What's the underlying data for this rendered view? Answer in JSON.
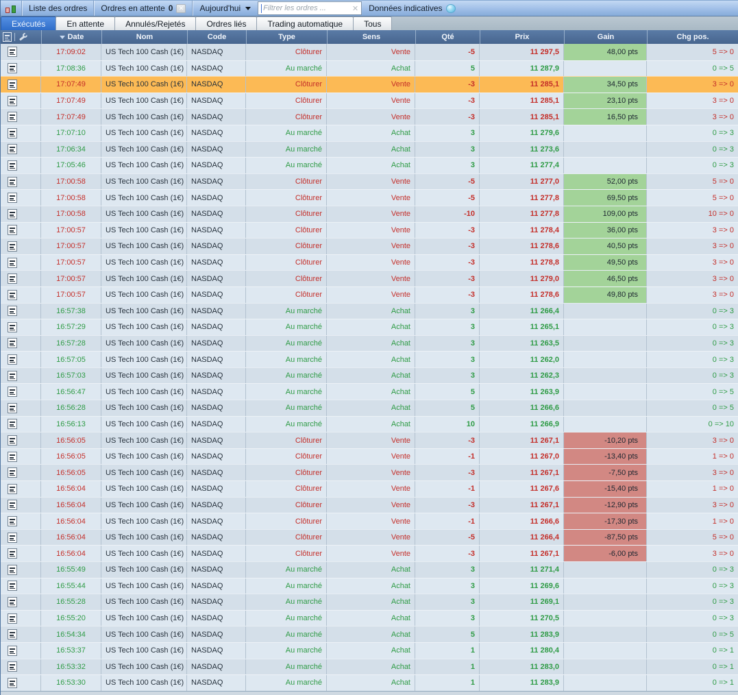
{
  "toolbar": {
    "app_icon": "candlestick-chart-icon",
    "liste_label": "Liste des ordres",
    "attente_label": "Ordres en attente",
    "attente_count": "0",
    "period_label": "Aujourd'hui",
    "filter_placeholder": "Filtrer les ordres ...",
    "clear_icon": "✕",
    "indicative_label": "Données indicatives",
    "indicative_icon": "globe-bubble-icon"
  },
  "tabs": [
    {
      "label": "Exécutés",
      "active": true
    },
    {
      "label": "En attente",
      "active": false
    },
    {
      "label": "Annulés/Rejetés",
      "active": false
    },
    {
      "label": "Ordres liés",
      "active": false
    },
    {
      "label": "Trading automatique",
      "active": false
    },
    {
      "label": "Tous",
      "active": false
    }
  ],
  "colors": {
    "highlight_row": "#fcba55",
    "gain_positive_bg": "#a3d399",
    "gain_negative_bg": "#d28883",
    "sell_text": "#c42e29",
    "buy_text": "#2e9b45",
    "active_tab": "#3f7cd6",
    "header_bg": "#4e6e98"
  },
  "table": {
    "columns": [
      "Date",
      "Nom",
      "Code",
      "Type",
      "Sens",
      "Qté",
      "Prix",
      "Gain",
      "Chg pos."
    ],
    "sort_column": "Date",
    "sort_direction": "desc",
    "rows": [
      {
        "time": "17:09:02",
        "dir": "sell",
        "name": "US Tech 100 Cash (1€)",
        "code": "NASDAQ",
        "type": "Clôturer",
        "sens": "Vente",
        "qty": "-5",
        "price": "11 297,5",
        "gain": "48,00 pts",
        "chg": "5 => 0",
        "highlight": false
      },
      {
        "time": "17:08:36",
        "dir": "buy",
        "name": "US Tech 100 Cash (1€)",
        "code": "NASDAQ",
        "type": "Au marché",
        "sens": "Achat",
        "qty": "5",
        "price": "11 287,9",
        "gain": "",
        "chg": "0 => 5",
        "highlight": false
      },
      {
        "time": "17:07:49",
        "dir": "sell",
        "name": "US Tech 100 Cash (1€)",
        "code": "NASDAQ",
        "type": "Clôturer",
        "sens": "Vente",
        "qty": "-3",
        "price": "11 285,1",
        "gain": "34,50 pts",
        "chg": "3 => 0",
        "highlight": true
      },
      {
        "time": "17:07:49",
        "dir": "sell",
        "name": "US Tech 100 Cash (1€)",
        "code": "NASDAQ",
        "type": "Clôturer",
        "sens": "Vente",
        "qty": "-3",
        "price": "11 285,1",
        "gain": "23,10 pts",
        "chg": "3 => 0",
        "highlight": false
      },
      {
        "time": "17:07:49",
        "dir": "sell",
        "name": "US Tech 100 Cash (1€)",
        "code": "NASDAQ",
        "type": "Clôturer",
        "sens": "Vente",
        "qty": "-3",
        "price": "11 285,1",
        "gain": "16,50 pts",
        "chg": "3 => 0",
        "highlight": false
      },
      {
        "time": "17:07:10",
        "dir": "buy",
        "name": "US Tech 100 Cash (1€)",
        "code": "NASDAQ",
        "type": "Au marché",
        "sens": "Achat",
        "qty": "3",
        "price": "11 279,6",
        "gain": "",
        "chg": "0 => 3",
        "highlight": false
      },
      {
        "time": "17:06:34",
        "dir": "buy",
        "name": "US Tech 100 Cash (1€)",
        "code": "NASDAQ",
        "type": "Au marché",
        "sens": "Achat",
        "qty": "3",
        "price": "11 273,6",
        "gain": "",
        "chg": "0 => 3",
        "highlight": false
      },
      {
        "time": "17:05:46",
        "dir": "buy",
        "name": "US Tech 100 Cash (1€)",
        "code": "NASDAQ",
        "type": "Au marché",
        "sens": "Achat",
        "qty": "3",
        "price": "11 277,4",
        "gain": "",
        "chg": "0 => 3",
        "highlight": false
      },
      {
        "time": "17:00:58",
        "dir": "sell",
        "name": "US Tech 100 Cash (1€)",
        "code": "NASDAQ",
        "type": "Clôturer",
        "sens": "Vente",
        "qty": "-5",
        "price": "11 277,0",
        "gain": "52,00 pts",
        "chg": "5 => 0",
        "highlight": false
      },
      {
        "time": "17:00:58",
        "dir": "sell",
        "name": "US Tech 100 Cash (1€)",
        "code": "NASDAQ",
        "type": "Clôturer",
        "sens": "Vente",
        "qty": "-5",
        "price": "11 277,8",
        "gain": "69,50 pts",
        "chg": "5 => 0",
        "highlight": false
      },
      {
        "time": "17:00:58",
        "dir": "sell",
        "name": "US Tech 100 Cash (1€)",
        "code": "NASDAQ",
        "type": "Clôturer",
        "sens": "Vente",
        "qty": "-10",
        "price": "11 277,8",
        "gain": "109,00 pts",
        "chg": "10 => 0",
        "highlight": false
      },
      {
        "time": "17:00:57",
        "dir": "sell",
        "name": "US Tech 100 Cash (1€)",
        "code": "NASDAQ",
        "type": "Clôturer",
        "sens": "Vente",
        "qty": "-3",
        "price": "11 278,4",
        "gain": "36,00 pts",
        "chg": "3 => 0",
        "highlight": false
      },
      {
        "time": "17:00:57",
        "dir": "sell",
        "name": "US Tech 100 Cash (1€)",
        "code": "NASDAQ",
        "type": "Clôturer",
        "sens": "Vente",
        "qty": "-3",
        "price": "11 278,6",
        "gain": "40,50 pts",
        "chg": "3 => 0",
        "highlight": false
      },
      {
        "time": "17:00:57",
        "dir": "sell",
        "name": "US Tech 100 Cash (1€)",
        "code": "NASDAQ",
        "type": "Clôturer",
        "sens": "Vente",
        "qty": "-3",
        "price": "11 278,8",
        "gain": "49,50 pts",
        "chg": "3 => 0",
        "highlight": false
      },
      {
        "time": "17:00:57",
        "dir": "sell",
        "name": "US Tech 100 Cash (1€)",
        "code": "NASDAQ",
        "type": "Clôturer",
        "sens": "Vente",
        "qty": "-3",
        "price": "11 279,0",
        "gain": "46,50 pts",
        "chg": "3 => 0",
        "highlight": false
      },
      {
        "time": "17:00:57",
        "dir": "sell",
        "name": "US Tech 100 Cash (1€)",
        "code": "NASDAQ",
        "type": "Clôturer",
        "sens": "Vente",
        "qty": "-3",
        "price": "11 278,6",
        "gain": "49,80 pts",
        "chg": "3 => 0",
        "highlight": false
      },
      {
        "time": "16:57:38",
        "dir": "buy",
        "name": "US Tech 100 Cash (1€)",
        "code": "NASDAQ",
        "type": "Au marché",
        "sens": "Achat",
        "qty": "3",
        "price": "11 266,4",
        "gain": "",
        "chg": "0 => 3",
        "highlight": false
      },
      {
        "time": "16:57:29",
        "dir": "buy",
        "name": "US Tech 100 Cash (1€)",
        "code": "NASDAQ",
        "type": "Au marché",
        "sens": "Achat",
        "qty": "3",
        "price": "11 265,1",
        "gain": "",
        "chg": "0 => 3",
        "highlight": false
      },
      {
        "time": "16:57:28",
        "dir": "buy",
        "name": "US Tech 100 Cash (1€)",
        "code": "NASDAQ",
        "type": "Au marché",
        "sens": "Achat",
        "qty": "3",
        "price": "11 263,5",
        "gain": "",
        "chg": "0 => 3",
        "highlight": false
      },
      {
        "time": "16:57:05",
        "dir": "buy",
        "name": "US Tech 100 Cash (1€)",
        "code": "NASDAQ",
        "type": "Au marché",
        "sens": "Achat",
        "qty": "3",
        "price": "11 262,0",
        "gain": "",
        "chg": "0 => 3",
        "highlight": false
      },
      {
        "time": "16:57:03",
        "dir": "buy",
        "name": "US Tech 100 Cash (1€)",
        "code": "NASDAQ",
        "type": "Au marché",
        "sens": "Achat",
        "qty": "3",
        "price": "11 262,3",
        "gain": "",
        "chg": "0 => 3",
        "highlight": false
      },
      {
        "time": "16:56:47",
        "dir": "buy",
        "name": "US Tech 100 Cash (1€)",
        "code": "NASDAQ",
        "type": "Au marché",
        "sens": "Achat",
        "qty": "5",
        "price": "11 263,9",
        "gain": "",
        "chg": "0 => 5",
        "highlight": false
      },
      {
        "time": "16:56:28",
        "dir": "buy",
        "name": "US Tech 100 Cash (1€)",
        "code": "NASDAQ",
        "type": "Au marché",
        "sens": "Achat",
        "qty": "5",
        "price": "11 266,6",
        "gain": "",
        "chg": "0 => 5",
        "highlight": false
      },
      {
        "time": "16:56:13",
        "dir": "buy",
        "name": "US Tech 100 Cash (1€)",
        "code": "NASDAQ",
        "type": "Au marché",
        "sens": "Achat",
        "qty": "10",
        "price": "11 266,9",
        "gain": "",
        "chg": "0 => 10",
        "highlight": false
      },
      {
        "time": "16:56:05",
        "dir": "sell",
        "name": "US Tech 100 Cash (1€)",
        "code": "NASDAQ",
        "type": "Clôturer",
        "sens": "Vente",
        "qty": "-3",
        "price": "11 267,1",
        "gain": "-10,20 pts",
        "chg": "3 => 0",
        "highlight": false
      },
      {
        "time": "16:56:05",
        "dir": "sell",
        "name": "US Tech 100 Cash (1€)",
        "code": "NASDAQ",
        "type": "Clôturer",
        "sens": "Vente",
        "qty": "-1",
        "price": "11 267,0",
        "gain": "-13,40 pts",
        "chg": "1 => 0",
        "highlight": false
      },
      {
        "time": "16:56:05",
        "dir": "sell",
        "name": "US Tech 100 Cash (1€)",
        "code": "NASDAQ",
        "type": "Clôturer",
        "sens": "Vente",
        "qty": "-3",
        "price": "11 267,1",
        "gain": "-7,50 pts",
        "chg": "3 => 0",
        "highlight": false
      },
      {
        "time": "16:56:04",
        "dir": "sell",
        "name": "US Tech 100 Cash (1€)",
        "code": "NASDAQ",
        "type": "Clôturer",
        "sens": "Vente",
        "qty": "-1",
        "price": "11 267,6",
        "gain": "-15,40 pts",
        "chg": "1 => 0",
        "highlight": false
      },
      {
        "time": "16:56:04",
        "dir": "sell",
        "name": "US Tech 100 Cash (1€)",
        "code": "NASDAQ",
        "type": "Clôturer",
        "sens": "Vente",
        "qty": "-3",
        "price": "11 267,1",
        "gain": "-12,90 pts",
        "chg": "3 => 0",
        "highlight": false
      },
      {
        "time": "16:56:04",
        "dir": "sell",
        "name": "US Tech 100 Cash (1€)",
        "code": "NASDAQ",
        "type": "Clôturer",
        "sens": "Vente",
        "qty": "-1",
        "price": "11 266,6",
        "gain": "-17,30 pts",
        "chg": "1 => 0",
        "highlight": false
      },
      {
        "time": "16:56:04",
        "dir": "sell",
        "name": "US Tech 100 Cash (1€)",
        "code": "NASDAQ",
        "type": "Clôturer",
        "sens": "Vente",
        "qty": "-5",
        "price": "11 266,4",
        "gain": "-87,50 pts",
        "chg": "5 => 0",
        "highlight": false
      },
      {
        "time": "16:56:04",
        "dir": "sell",
        "name": "US Tech 100 Cash (1€)",
        "code": "NASDAQ",
        "type": "Clôturer",
        "sens": "Vente",
        "qty": "-3",
        "price": "11 267,1",
        "gain": "-6,00 pts",
        "chg": "3 => 0",
        "highlight": false
      },
      {
        "time": "16:55:49",
        "dir": "buy",
        "name": "US Tech 100 Cash (1€)",
        "code": "NASDAQ",
        "type": "Au marché",
        "sens": "Achat",
        "qty": "3",
        "price": "11 271,4",
        "gain": "",
        "chg": "0 => 3",
        "highlight": false
      },
      {
        "time": "16:55:44",
        "dir": "buy",
        "name": "US Tech 100 Cash (1€)",
        "code": "NASDAQ",
        "type": "Au marché",
        "sens": "Achat",
        "qty": "3",
        "price": "11 269,6",
        "gain": "",
        "chg": "0 => 3",
        "highlight": false
      },
      {
        "time": "16:55:28",
        "dir": "buy",
        "name": "US Tech 100 Cash (1€)",
        "code": "NASDAQ",
        "type": "Au marché",
        "sens": "Achat",
        "qty": "3",
        "price": "11 269,1",
        "gain": "",
        "chg": "0 => 3",
        "highlight": false
      },
      {
        "time": "16:55:20",
        "dir": "buy",
        "name": "US Tech 100 Cash (1€)",
        "code": "NASDAQ",
        "type": "Au marché",
        "sens": "Achat",
        "qty": "3",
        "price": "11 270,5",
        "gain": "",
        "chg": "0 => 3",
        "highlight": false
      },
      {
        "time": "16:54:34",
        "dir": "buy",
        "name": "US Tech 100 Cash (1€)",
        "code": "NASDAQ",
        "type": "Au marché",
        "sens": "Achat",
        "qty": "5",
        "price": "11 283,9",
        "gain": "",
        "chg": "0 => 5",
        "highlight": false
      },
      {
        "time": "16:53:37",
        "dir": "buy",
        "name": "US Tech 100 Cash (1€)",
        "code": "NASDAQ",
        "type": "Au marché",
        "sens": "Achat",
        "qty": "1",
        "price": "11 280,4",
        "gain": "",
        "chg": "0 => 1",
        "highlight": false
      },
      {
        "time": "16:53:32",
        "dir": "buy",
        "name": "US Tech 100 Cash (1€)",
        "code": "NASDAQ",
        "type": "Au marché",
        "sens": "Achat",
        "qty": "1",
        "price": "11 283,0",
        "gain": "",
        "chg": "0 => 1",
        "highlight": false
      },
      {
        "time": "16:53:30",
        "dir": "buy",
        "name": "US Tech 100 Cash (1€)",
        "code": "NASDAQ",
        "type": "Au marché",
        "sens": "Achat",
        "qty": "1",
        "price": "11 283,9",
        "gain": "",
        "chg": "0 => 1",
        "highlight": false
      }
    ]
  }
}
